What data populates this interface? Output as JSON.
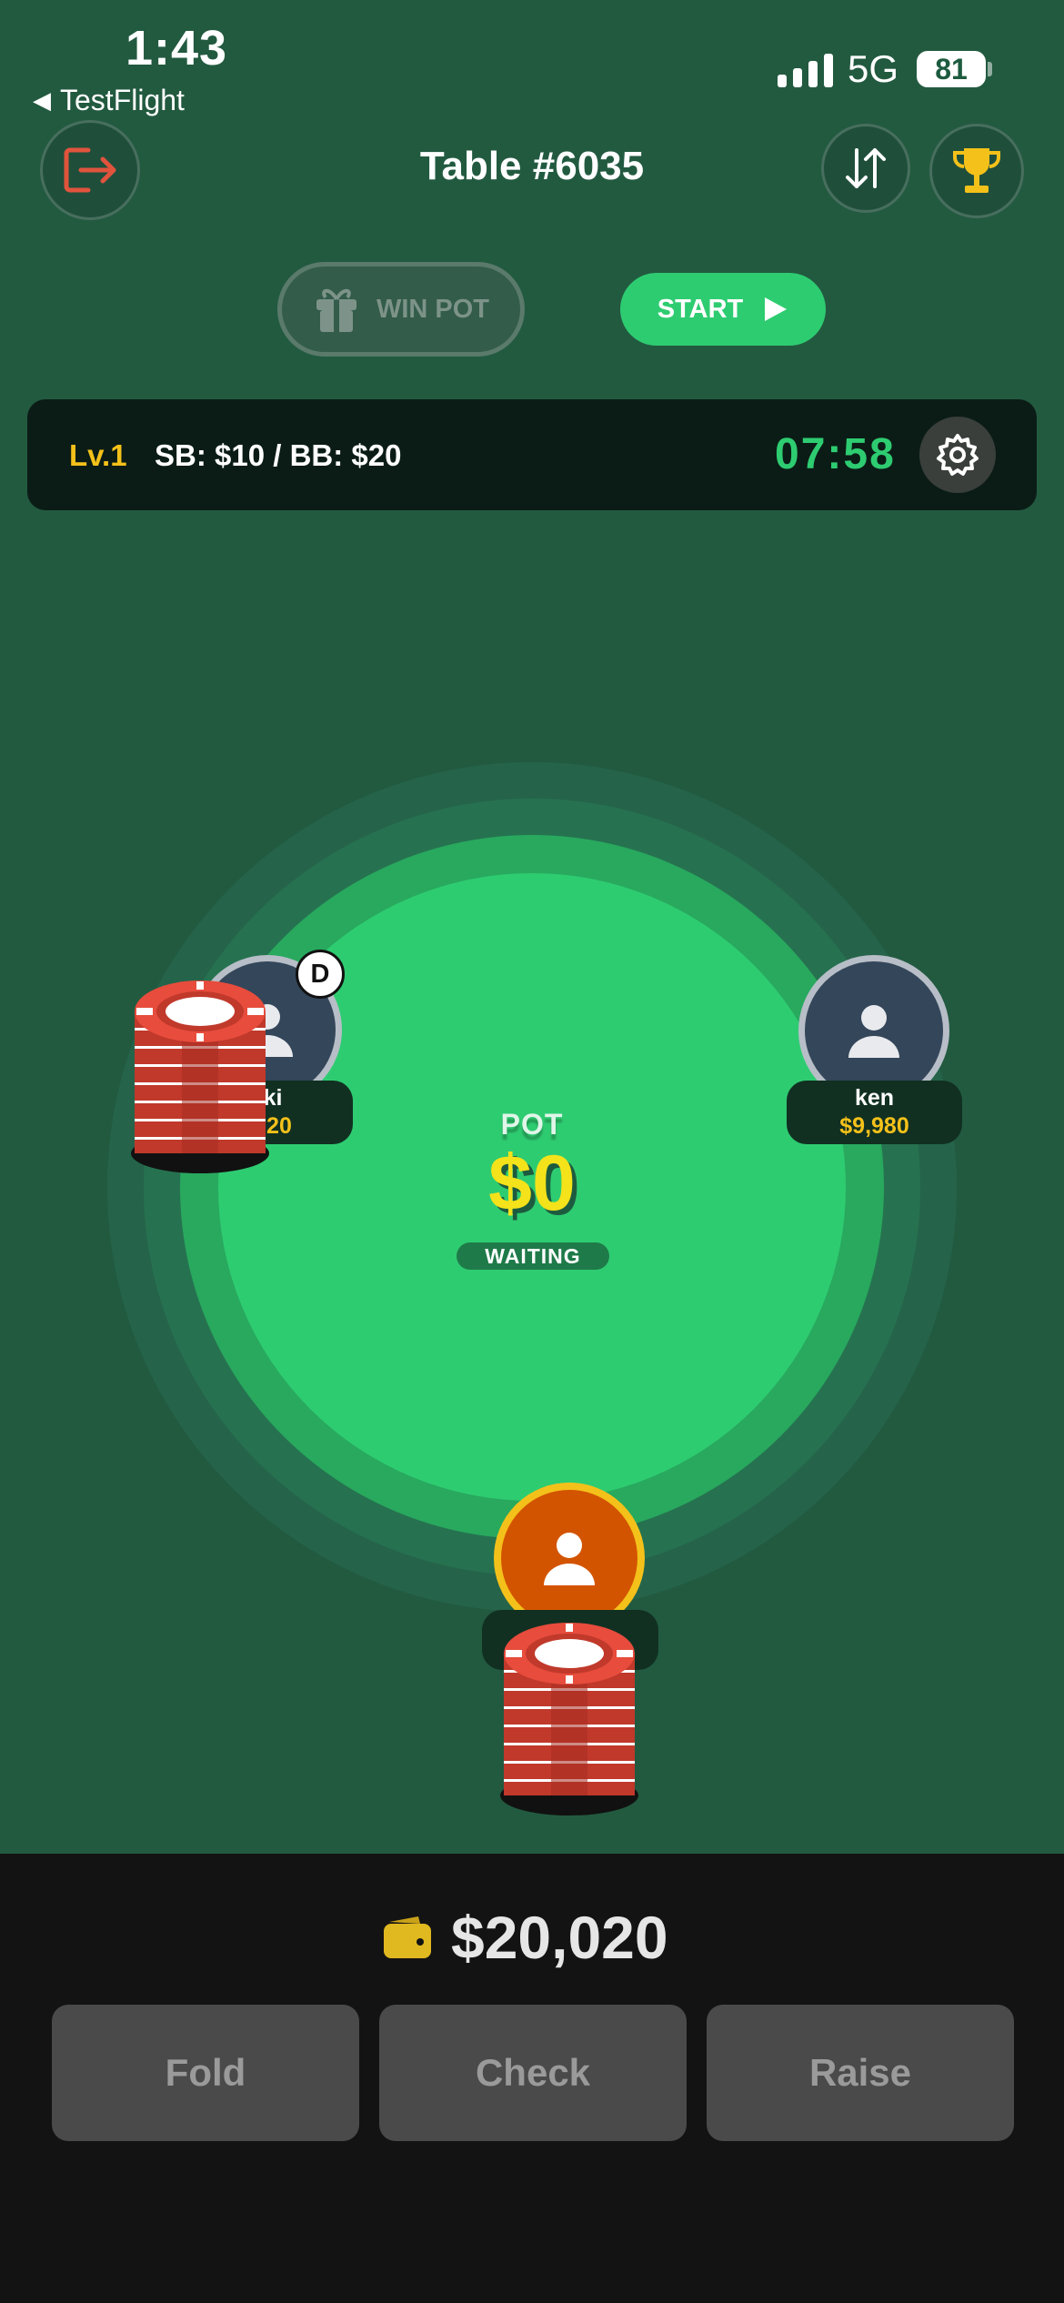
{
  "status_bar": {
    "time": "1:43",
    "back_app": "TestFlight",
    "network": "5G",
    "battery": "81"
  },
  "header": {
    "title": "Table #6035"
  },
  "controls": {
    "win_pot_label": "WIN POT",
    "start_label": "START"
  },
  "blinds_bar": {
    "level": "Lv.1",
    "blinds": "SB: $10 / BB: $20",
    "timer": "07:58"
  },
  "pot": {
    "label": "POT",
    "value": "$0",
    "status": "WAITING"
  },
  "seats": {
    "left": {
      "name": "ki",
      "chips": "020",
      "dealer_badge": "D"
    },
    "right": {
      "name": "ken",
      "chips": "$9,980"
    },
    "me": {
      "name": "",
      "chips": ""
    }
  },
  "wallet": {
    "balance": "$20,020"
  },
  "actions": {
    "fold": "Fold",
    "check": "Check",
    "raise": "Raise"
  },
  "colors": {
    "background": "#225a40",
    "felt": "#2ecc71",
    "accent_green": "#2ecc71",
    "gold": "#f4c11a",
    "exit_icon": "#e0533d",
    "my_avatar": "#d35400"
  }
}
